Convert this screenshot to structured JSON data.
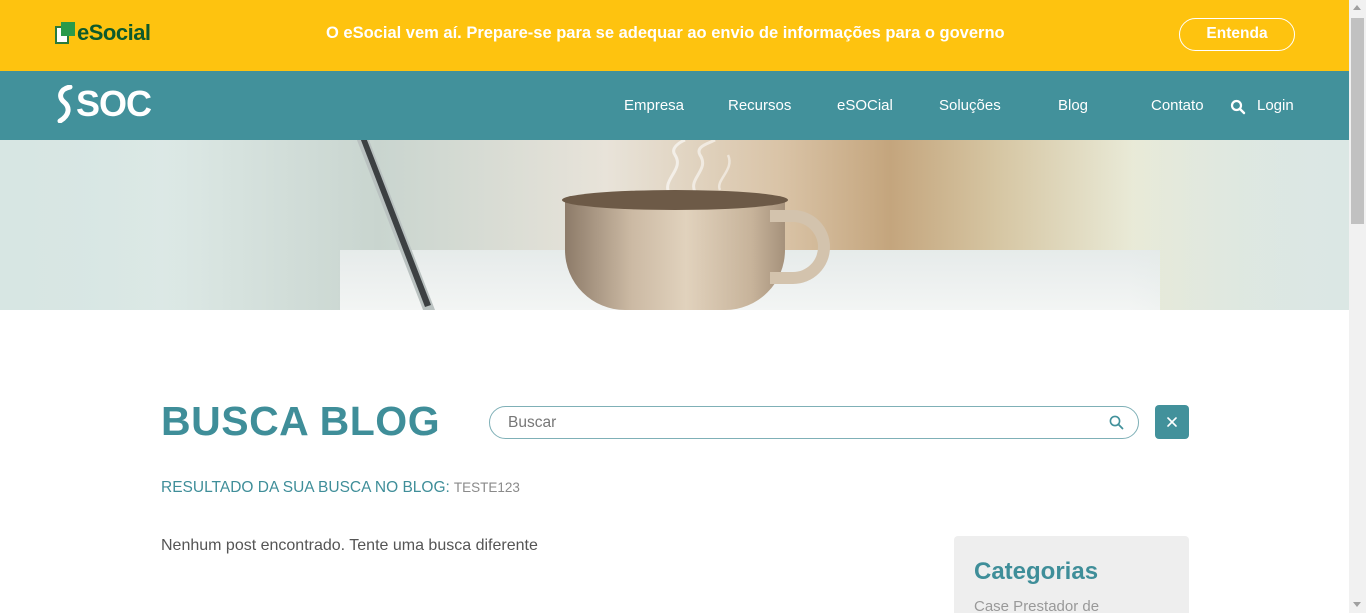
{
  "banner": {
    "logo_text": "eSocial",
    "message": "O eSocial vem aí. Prepare-se para se adequar ao envio de informações para o governo",
    "button_label": "Entenda",
    "background": "#fec30f"
  },
  "navbar": {
    "logo_text": "SOC",
    "background": "#42919b",
    "items": [
      {
        "label": "Empresa"
      },
      {
        "label": "Recursos"
      },
      {
        "label": "eSOCial"
      },
      {
        "label": "Soluções"
      },
      {
        "label": "Blog"
      },
      {
        "label": "Contato"
      }
    ],
    "login_label": "Login"
  },
  "main": {
    "title": "BUSCA BLOG",
    "search": {
      "placeholder": "Buscar",
      "value": ""
    },
    "result_label": "RESULTADO DA SUA BUSCA NO BLOG:",
    "result_term": "TESTE123",
    "empty_message": "Nenhum post encontrado. Tente uma busca diferente"
  },
  "sidebar": {
    "categories_title": "Categorias",
    "categories": [
      {
        "label": "Case Prestador de"
      }
    ]
  },
  "colors": {
    "accent": "#42919b",
    "title": "#3f8e99",
    "banner": "#fec30f"
  }
}
